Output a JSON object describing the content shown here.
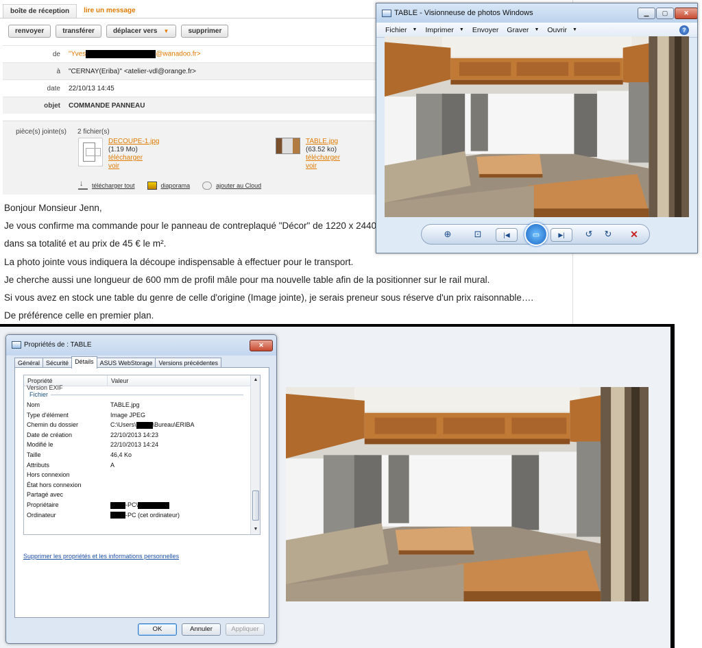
{
  "email": {
    "tabs": [
      "boîte de réception",
      "lire un message"
    ],
    "toolbar": {
      "reply": "renvoyer",
      "forward": "transférer",
      "move": "déplacer vers",
      "delete": "supprimer"
    },
    "headers": {
      "from_label": "de",
      "from_value": "\"Yves",
      "from_domain": "@wanadoo.fr>",
      "to_label": "à",
      "to_value": "\"CERNAY(Eriba)\" <atelier-vdl@orange.fr>",
      "date_label": "date",
      "date_value": "22/10/13 14:45",
      "subject_label": "objet",
      "subject_value": "COMMANDE PANNEAU"
    },
    "attachments": {
      "label": "pièce(s) jointe(s)",
      "count": "2 fichier(s)",
      "files": [
        {
          "name": "DECOUPE-1.jpg",
          "size": "(1.19 Mo)",
          "download": "télécharger",
          "view": "voir"
        },
        {
          "name": "TABLE.jpg",
          "size": "(63.52 ko)",
          "download": "télécharger",
          "view": "voir"
        }
      ],
      "actions": {
        "download_all": "télécharger tout",
        "slideshow": "diaporama",
        "cloud": "ajouter au Cloud"
      }
    },
    "body": [
      "Bonjour Monsieur Jenn,",
      "Je vous confirme ma commande pour le panneau de contreplaqué \"Décor\" de 1220 x 2440,",
      "dans sa totalité et au prix de 45 € le m².",
      "La photo jointe vous indiquera la découpe indispensable à effectuer pour le transport.",
      "Je cherche aussi une longueur de 600 mm de profil mâle pour ma nouvelle table afin de la positionner sur le rail mural.",
      "Si vous avez en stock une table du genre de celle d'origine (Image jointe), je serais preneur sous réserve d'un prix raisonnable….",
      "De préférence celle en premier plan."
    ]
  },
  "viewer": {
    "title": "TABLE - Visionneuse de photos Windows",
    "menu": [
      "Fichier",
      "Imprimer",
      "Envoyer",
      "Graver",
      "Ouvrir"
    ],
    "help": "?"
  },
  "properties": {
    "title": "Propriétés de : TABLE",
    "tabs": [
      "Général",
      "Sécurité",
      "Détails",
      "ASUS WebStorage",
      "Versions précédentes"
    ],
    "col_property": "Propriété",
    "col_value": "Valeur",
    "cut_row": "Version EXIF",
    "group": "Fichier",
    "rows": [
      {
        "k": "Nom",
        "v": "TABLE.jpg"
      },
      {
        "k": "Type d'élément",
        "v": "Image JPEG"
      },
      {
        "k": "Chemin du dossier",
        "v": "C:\\Users\\",
        "v2": "\\Bureau\\ERIBA"
      },
      {
        "k": "Date de création",
        "v": "22/10/2013 14:23"
      },
      {
        "k": "Modifié le",
        "v": "22/10/2013 14:24"
      },
      {
        "k": "Taille",
        "v": "46,4 Ko"
      },
      {
        "k": "Attributs",
        "v": "A"
      },
      {
        "k": "Hors connexion",
        "v": ""
      },
      {
        "k": "État hors connexion",
        "v": ""
      },
      {
        "k": "Partagé avec",
        "v": ""
      },
      {
        "k": "Propriétaire",
        "v": "-PC\\"
      },
      {
        "k": "Ordinateur",
        "v": "-PC (cet ordinateur)"
      }
    ],
    "remove_link": "Supprimer les propriétés et les informations personnelles",
    "buttons": {
      "ok": "OK",
      "cancel": "Annuler",
      "apply": "Appliquer"
    }
  },
  "colors": {
    "accent_orange": "#e07a00",
    "link_blue": "#1a4fa6",
    "close_red": "#c74a30"
  }
}
